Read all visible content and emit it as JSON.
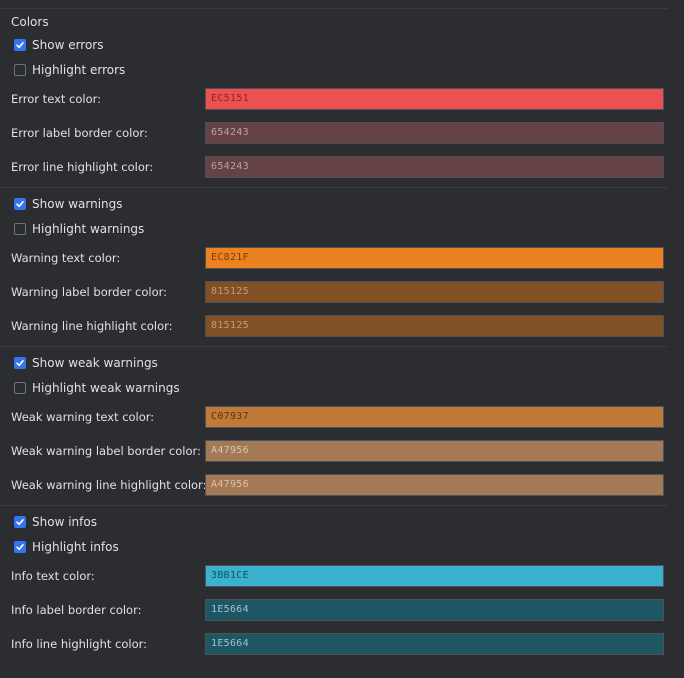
{
  "title": "Colors",
  "groups": [
    {
      "show_label": "Show errors",
      "show_checked": true,
      "highlight_label": "Highlight errors",
      "highlight_checked": false,
      "rows": [
        {
          "label": "Error text color:",
          "hex": "EC5151",
          "bg": "#ec5151",
          "fg": "#8a2828"
        },
        {
          "label": "Error label border color:",
          "hex": "654243",
          "bg": "#654243",
          "fg": "#b9a1a2"
        },
        {
          "label": "Error line highlight color:",
          "hex": "654243",
          "bg": "#654243",
          "fg": "#b9a1a2"
        }
      ]
    },
    {
      "show_label": "Show warnings",
      "show_checked": true,
      "highlight_label": "Highlight warnings",
      "highlight_checked": false,
      "rows": [
        {
          "label": "Warning text color:",
          "hex": "EC821F",
          "bg": "#ec821f",
          "fg": "#7a3f0a"
        },
        {
          "label": "Warning label border color:",
          "hex": "815125",
          "bg": "#815125",
          "fg": "#c79a72"
        },
        {
          "label": "Warning line highlight color:",
          "hex": "815125",
          "bg": "#815125",
          "fg": "#c79a72"
        }
      ]
    },
    {
      "show_label": "Show weak warnings",
      "show_checked": true,
      "highlight_label": "Highlight weak warnings",
      "highlight_checked": false,
      "rows": [
        {
          "label": "Weak warning text color:",
          "hex": "C07937",
          "bg": "#c07937",
          "fg": "#5c3510"
        },
        {
          "label": "Weak warning label border color:",
          "hex": "A47956",
          "bg": "#a47956",
          "fg": "#ddc3ad"
        },
        {
          "label": "Weak warning line highlight color:",
          "hex": "A47956",
          "bg": "#a47956",
          "fg": "#ddc3ad"
        }
      ]
    },
    {
      "show_label": "Show infos",
      "show_checked": true,
      "highlight_label": "Highlight infos",
      "highlight_checked": true,
      "rows": [
        {
          "label": "Info text color:",
          "hex": "3BB1CE",
          "bg": "#3bb1ce",
          "fg": "#0f5566"
        },
        {
          "label": "Info label border color:",
          "hex": "1E5664",
          "bg": "#1e5664",
          "fg": "#9ec3cc"
        },
        {
          "label": "Info line highlight color:",
          "hex": "1E5664",
          "bg": "#1e5664",
          "fg": "#9ec3cc"
        }
      ]
    }
  ]
}
